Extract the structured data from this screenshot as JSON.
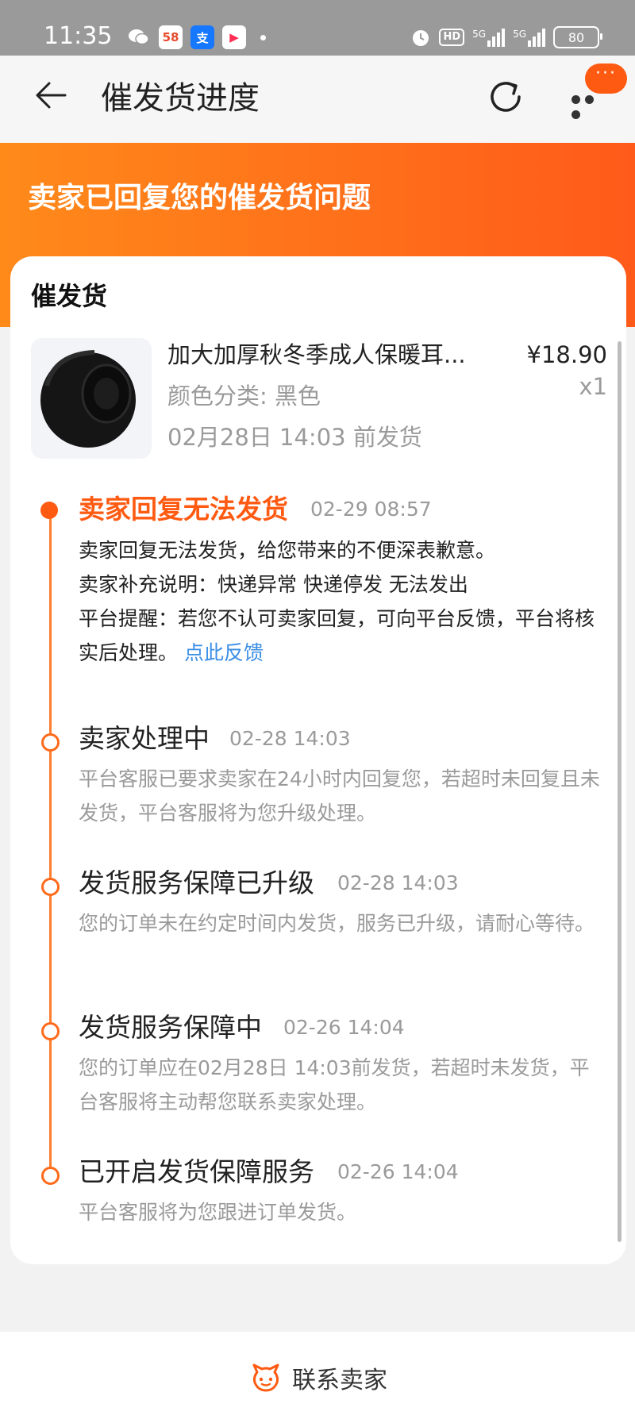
{
  "status_bar": {
    "time": "11:35",
    "apps": [
      {
        "name": "wechat-icon"
      },
      {
        "name": "58-icon",
        "label": "58",
        "color": "#e64b2b"
      },
      {
        "name": "alipay-icon",
        "label": "支",
        "color": "#1677ff"
      },
      {
        "name": "video-icon",
        "label": "▶",
        "color": "#ff2d55"
      }
    ],
    "hd": "HD",
    "net1": "5G",
    "net2": "5G",
    "battery": "80"
  },
  "nav": {
    "title": "催发货进度",
    "more_bubble": "···"
  },
  "banner": {
    "title": "卖家已回复您的催发货问题"
  },
  "card": {
    "title": "催发货",
    "product": {
      "name": "加大加厚秋冬季成人保暖耳...",
      "spec": "颜色分类: 黑色",
      "ship_by": "02月28日 14:03 前发货",
      "price": "¥18.90",
      "qty": "x1"
    },
    "events": [
      {
        "title": "卖家回复无法发货",
        "time": "02-29 08:57",
        "lines": [
          "卖家回复无法发货，给您带来的不便深表歉意。",
          "卖家补充说明：快递异常 快递停发 无法发出",
          "平台提醒：若您不认可卖家回复，可向平台反馈，平台将核实后处理。"
        ],
        "link": "点此反馈"
      },
      {
        "title": "卖家处理中",
        "time": "02-28 14:03",
        "body": "平台客服已要求卖家在24小时内回复您，若超时未回复且未发货，平台客服将为您升级处理。"
      },
      {
        "title": "发货服务保障已升级",
        "time": "02-28 14:03",
        "body": "您的订单未在约定时间内发货，服务已升级，请耐心等待。"
      },
      {
        "title": "发货服务保障中",
        "time": "02-26 14:04",
        "body": "您的订单应在02月28日 14:03前发货，若超时未发货，平台客服将主动帮您联系卖家处理。"
      },
      {
        "title": "已开启发货保障服务",
        "time": "02-26 14:04",
        "body": "平台客服将为您跟进订单发货。"
      }
    ]
  },
  "footer": {
    "contact_label": "联系卖家"
  },
  "colors": {
    "accent": "#ff5a12",
    "link": "#3a8ee6",
    "banner_start": "#ff8a1a",
    "banner_end": "#ff5a1a"
  }
}
